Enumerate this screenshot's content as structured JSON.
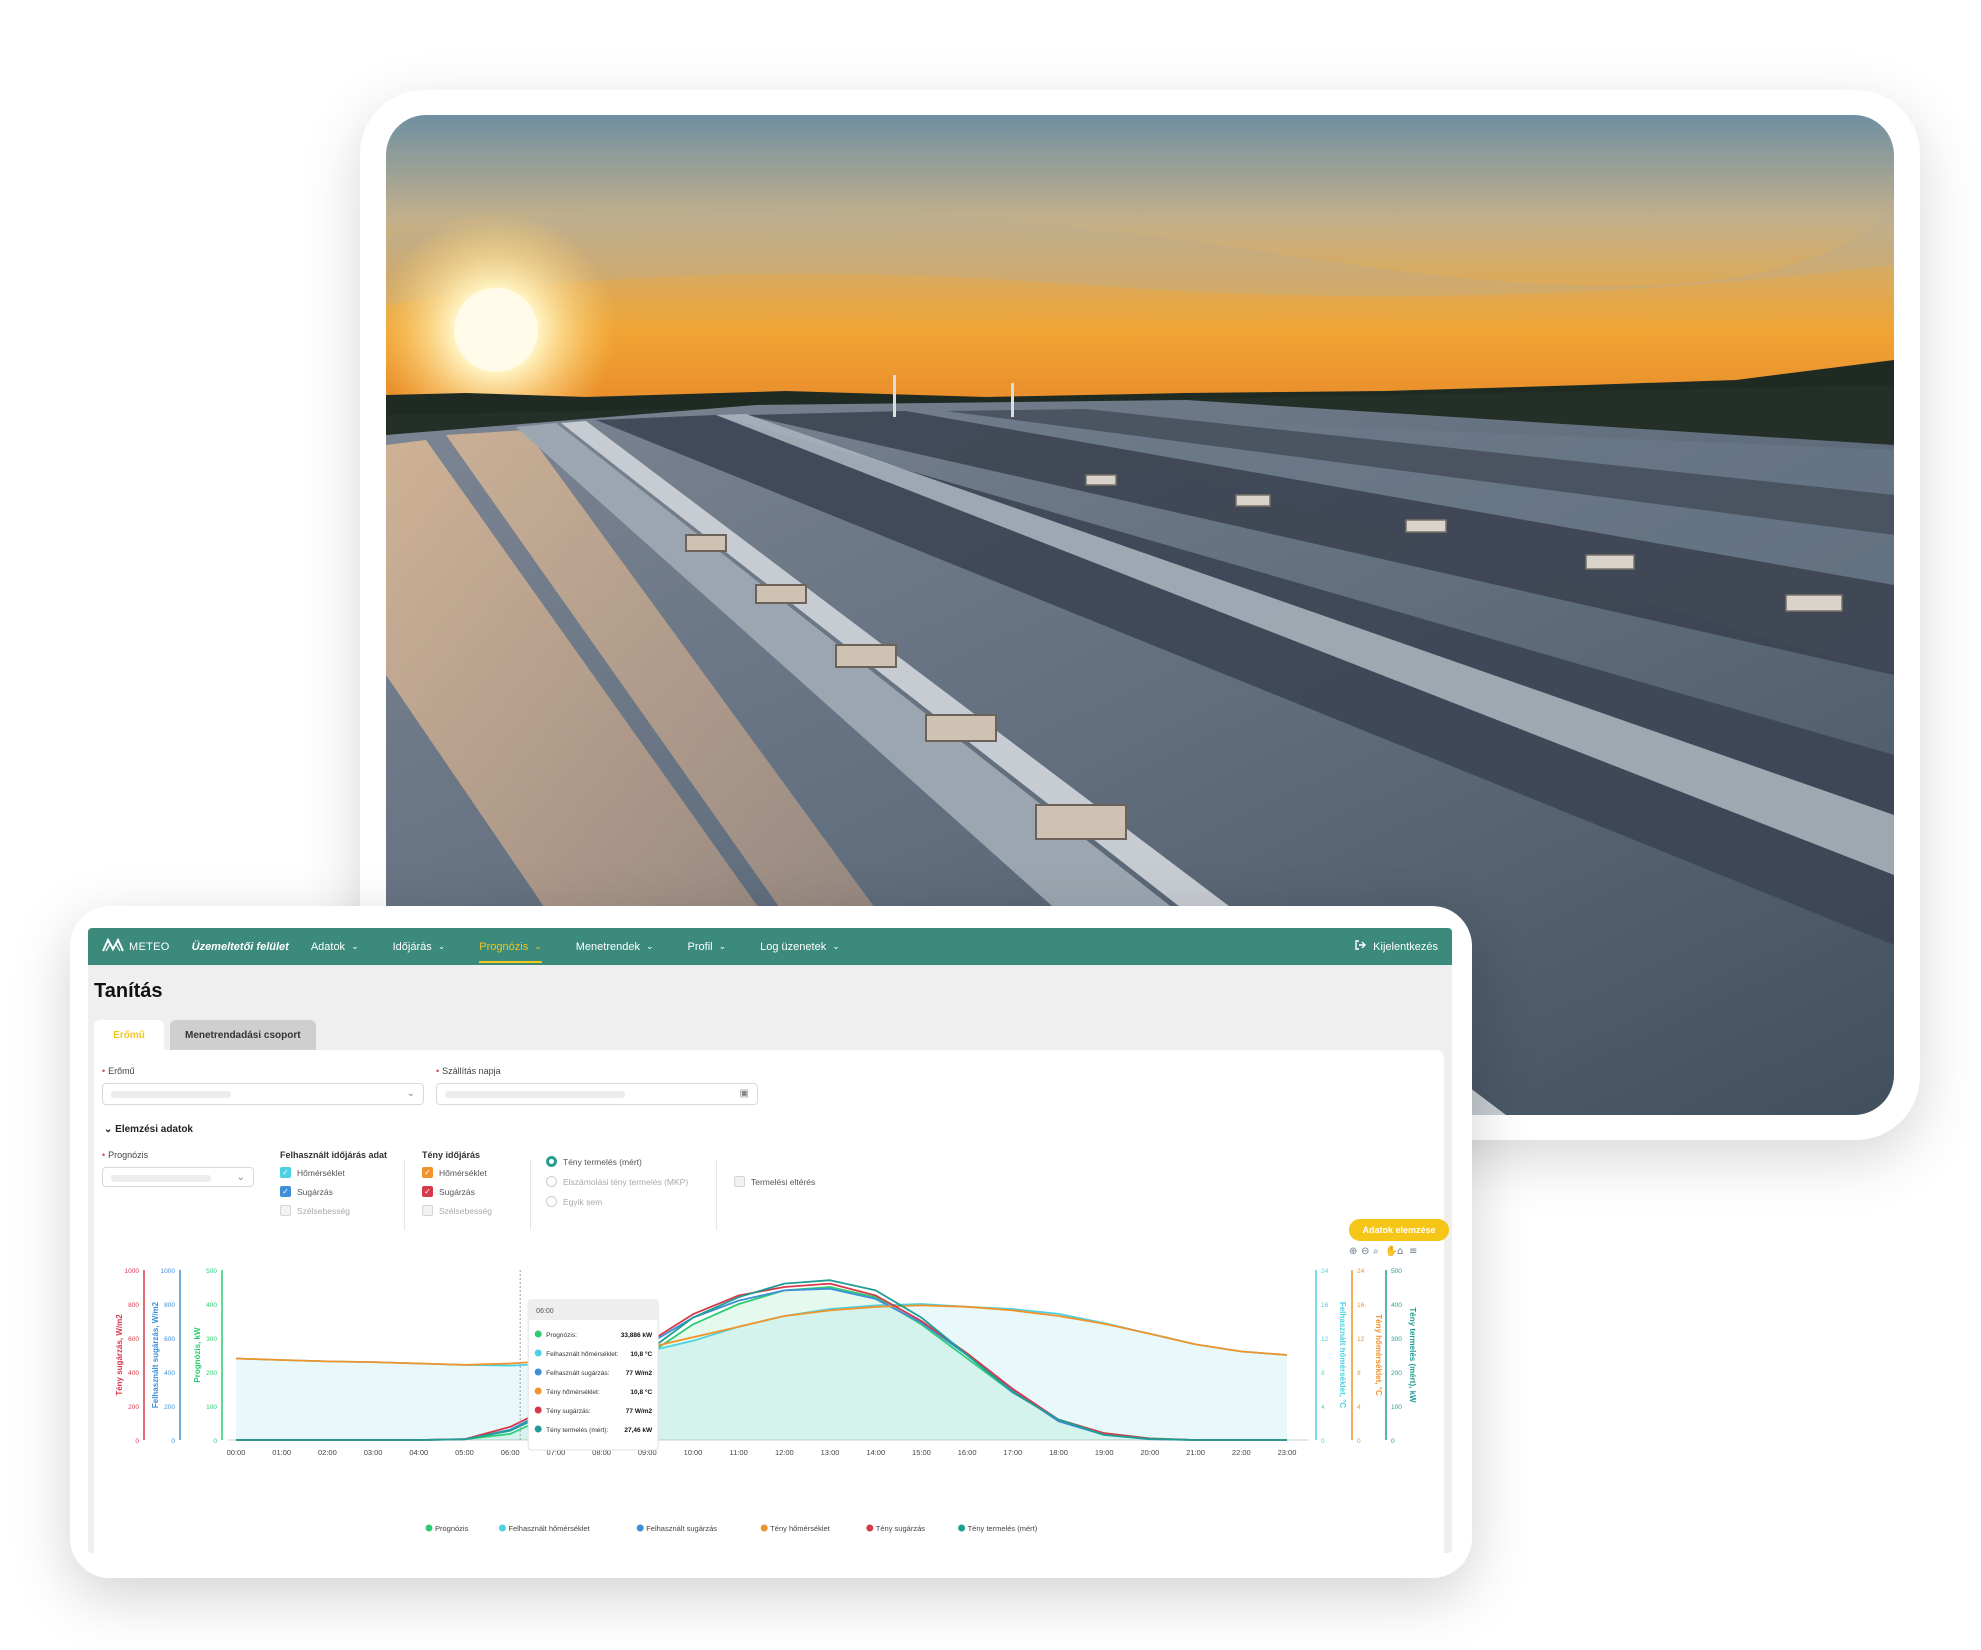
{
  "app": {
    "brand": "METEO",
    "subtitle": "Üzemeltetői felület",
    "nav": [
      {
        "label": "Adatok"
      },
      {
        "label": "Időjárás"
      },
      {
        "label": "Prognózis"
      },
      {
        "label": "Menetrendek"
      },
      {
        "label": "Profil"
      },
      {
        "label": "Log üzenetek"
      }
    ],
    "active_nav": "Prognózis",
    "logout": "Kijelentkezés"
  },
  "page": {
    "title": "Tanítás",
    "tabs": [
      "Erőmű",
      "Menetrendadási csoport"
    ]
  },
  "form": {
    "plant_label": "Erőmű",
    "delivery_label": "Szállítás napja",
    "section": "Elemzési adatok",
    "forecast_label": "Prognózis",
    "used_weather_head": "Felhasznált időjárás adat",
    "actual_weather_head": "Tény időjárás",
    "weather_items": [
      "Hőmérséklet",
      "Sugárzás",
      "Szélsebesség"
    ],
    "production_options": [
      "Tény termelés (mért)",
      "Elszámolási tény termelés (MKP)",
      "Egyik sem"
    ],
    "deviation_label": "Termelési eltérés",
    "analyze_button": "Adatok elemzése"
  },
  "colors": {
    "nav_bg": "#3b8a7c",
    "accent": "#f5c518",
    "prognozis": "#2ecc71",
    "felh_homerseklet": "#4dd0e1",
    "felh_sugarzas": "#3d8fd6",
    "teny_homerseklet": "#f0932b",
    "teny_sugarzas": "#d63a4a",
    "teny_termeles": "#1f9e96"
  },
  "chart_data": {
    "type": "line",
    "x": [
      "00:00",
      "01:00",
      "02:00",
      "03:00",
      "04:00",
      "05:00",
      "06:00",
      "07:00",
      "08:00",
      "09:00",
      "10:00",
      "11:00",
      "12:00",
      "13:00",
      "14:00",
      "15:00",
      "16:00",
      "17:00",
      "18:00",
      "19:00",
      "20:00",
      "21:00",
      "22:00",
      "23:00"
    ],
    "y_axes": {
      "left": [
        {
          "label": "Tény sugárzás, W/m2",
          "ticks": [
            "1000",
            "800",
            "600",
            "400",
            "200",
            "0"
          ],
          "ylim": [
            0,
            1000
          ]
        },
        {
          "label": "Felhasznált sugárzás, W/m2",
          "ticks": [
            "1000",
            "800",
            "600",
            "400",
            "200",
            "0"
          ],
          "ylim": [
            0,
            1000
          ]
        },
        {
          "label": "Prognózis, kW",
          "ticks": [
            "500",
            "400",
            "300",
            "200",
            "100",
            "0"
          ],
          "ylim": [
            0,
            500
          ]
        }
      ],
      "right": [
        {
          "label": "Felhasznált hőmérséklet, °C",
          "ticks": [
            "24",
            "16",
            "12",
            "8",
            "4",
            "0"
          ],
          "ylim": [
            0,
            24
          ]
        },
        {
          "label": "Tény hőmérséklet, °C",
          "ticks": [
            "24",
            "16",
            "12",
            "8",
            "4",
            "0"
          ],
          "ylim": [
            0,
            24
          ]
        },
        {
          "label": "Tény termelés (mért), kW",
          "ticks": [
            "500",
            "400",
            "300",
            "200",
            "100",
            "0"
          ],
          "ylim": [
            0,
            500
          ]
        }
      ]
    },
    "series": [
      {
        "name": "Prognózis",
        "unit": "kW",
        "values": [
          0,
          0,
          0,
          0,
          0,
          2,
          18,
          80,
          160,
          250,
          340,
          400,
          440,
          450,
          420,
          340,
          240,
          140,
          60,
          20,
          5,
          0,
          0,
          0
        ]
      },
      {
        "name": "Felhasznált hőmérséklet",
        "unit": "°C",
        "values": [
          11.5,
          11.3,
          11.1,
          11.0,
          10.8,
          10.6,
          10.5,
          10.8,
          11.5,
          12.5,
          14.0,
          16.0,
          17.5,
          18.5,
          19.0,
          19.2,
          18.8,
          18.5,
          17.8,
          16.5,
          15.0,
          13.5,
          12.5,
          12.0
        ]
      },
      {
        "name": "Felhasznált sugárzás",
        "unit": "W/m2",
        "values": [
          0,
          0,
          0,
          0,
          0,
          5,
          60,
          200,
          380,
          560,
          720,
          820,
          880,
          890,
          830,
          690,
          500,
          290,
          110,
          30,
          5,
          0,
          0,
          0
        ]
      },
      {
        "name": "Tény hőmérséklet",
        "unit": "°C",
        "values": [
          11.5,
          11.3,
          11.1,
          11.0,
          10.8,
          10.6,
          10.8,
          11.2,
          12.0,
          13.0,
          14.5,
          16.0,
          17.5,
          18.3,
          18.8,
          19.0,
          18.8,
          18.3,
          17.5,
          16.4,
          15.0,
          13.5,
          12.5,
          12.0
        ]
      },
      {
        "name": "Tény sugárzás",
        "unit": "W/m2",
        "values": [
          0,
          0,
          0,
          0,
          0,
          5,
          77,
          210,
          390,
          570,
          740,
          850,
          900,
          920,
          850,
          700,
          510,
          300,
          120,
          40,
          8,
          0,
          0,
          0
        ]
      },
      {
        "name": "Tény termelés (mért)",
        "unit": "kW",
        "values": [
          0,
          0,
          0,
          0,
          0,
          2,
          27.46,
          90,
          170,
          260,
          360,
          420,
          460,
          470,
          440,
          360,
          250,
          140,
          60,
          15,
          3,
          0,
          0,
          0
        ]
      }
    ],
    "tooltip": {
      "time": "06:00",
      "rows": [
        {
          "label": "Prognózis:",
          "value": "33,886 kW"
        },
        {
          "label": "Felhasznált hőmérséklet:",
          "value": "10,8 °C"
        },
        {
          "label": "Felhasznált sugárzás:",
          "value": "77 W/m2"
        },
        {
          "label": "Tény hőmérséklet:",
          "value": "10,8 °C"
        },
        {
          "label": "Tény sugárzás:",
          "value": "77 W/m2"
        },
        {
          "label": "Tény termelés (mért):",
          "value": "27,46 kW"
        }
      ]
    },
    "legend": [
      "Prognózis",
      "Felhasznált hőmérséklet",
      "Felhasznált sugárzás",
      "Tény hőmérséklet",
      "Tény sugárzás",
      "Tény termelés (mért)"
    ],
    "legend_position": "bottom",
    "grid": false
  }
}
